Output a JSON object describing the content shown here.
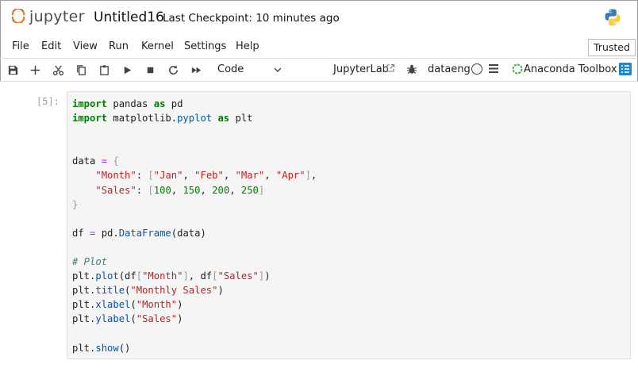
{
  "header": {
    "logo_text": "jupyter",
    "notebook_title": "Untitled16",
    "checkpoint": "Last Checkpoint: 10 minutes ago"
  },
  "menu": {
    "items": [
      "File",
      "Edit",
      "View",
      "Run",
      "Kernel",
      "Settings",
      "Help"
    ],
    "trusted_label": "Trusted"
  },
  "toolbar": {
    "icons": [
      "save-icon",
      "add-cell-icon",
      "cut-icon",
      "copy-icon",
      "paste-icon",
      "run-icon",
      "stop-icon",
      "restart-icon",
      "run-all-icon"
    ],
    "cell_type": "Code",
    "jupyterlab_label": "JupyterLab",
    "kernel_name": "dataeng",
    "anaconda_label": "Anaconda Toolbox"
  },
  "cell": {
    "prompt": "[5]:",
    "lines": [
      "import pandas as pd",
      "import matplotlib.pyplot as plt",
      "",
      "",
      "data = {",
      "    \"Month\": [\"Jan\", \"Feb\", \"Mar\", \"Apr\"],",
      "    \"Sales\": [100, 150, 200, 250]",
      "}",
      "",
      "df = pd.DataFrame(data)",
      "",
      "# Plot",
      "plt.plot(df[\"Month\"], df[\"Sales\"])",
      "plt.title(\"Monthly Sales\")",
      "plt.xlabel(\"Month\")",
      "plt.ylabel(\"Sales\")",
      "",
      "plt.show()"
    ]
  },
  "colors": {
    "jupyter_orange": "#f37726",
    "keyword": "#008000",
    "string": "#ba2121",
    "comment": "#408080",
    "anaconda_green": "#43b049",
    "toolbox_blue": "#1e88c8"
  }
}
